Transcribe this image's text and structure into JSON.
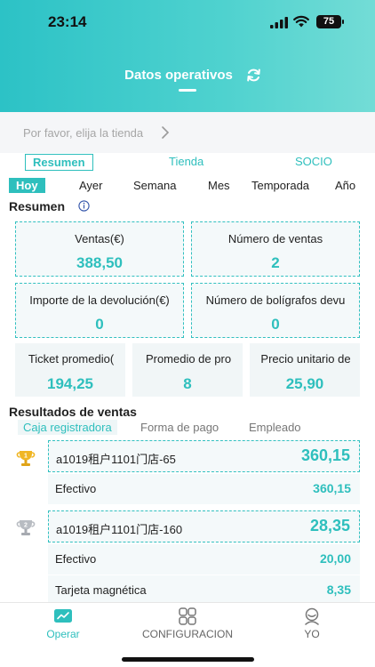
{
  "status_bar": {
    "time": "23:14",
    "battery": "75"
  },
  "header": {
    "title": "Datos operativos"
  },
  "store_selector": {
    "placeholder": "Por favor, elija la tienda"
  },
  "main_tabs": [
    {
      "label": "Resumen",
      "active": true
    },
    {
      "label": "Tienda",
      "active": false
    },
    {
      "label": "SOCIO",
      "active": false
    }
  ],
  "period_tabs": [
    {
      "label": "Hoy",
      "active": true
    },
    {
      "label": "Ayer",
      "active": false
    },
    {
      "label": "Semana",
      "active": false
    },
    {
      "label": "Mes",
      "active": false
    },
    {
      "label": "Temporada",
      "active": false
    },
    {
      "label": "Año",
      "active": false
    }
  ],
  "summary": {
    "title": "Resumen",
    "cards": [
      {
        "label": "Ventas(€)",
        "value": "388,50"
      },
      {
        "label": "Número de ventas",
        "value": "2"
      },
      {
        "label": "Importe de la devolución(€)",
        "value": "0"
      },
      {
        "label": "Número de bolígrafos devu",
        "value": "0"
      }
    ],
    "small_cards": [
      {
        "label": "Ticket promedio(",
        "value": "194,25"
      },
      {
        "label": "Promedio de pro",
        "value": "8"
      },
      {
        "label": "Precio unitario de",
        "value": "25,90"
      }
    ]
  },
  "sales_results": {
    "title": "Resultados de ventas",
    "tabs": [
      {
        "label": "Caja registradora",
        "active": true
      },
      {
        "label": "Forma de pago",
        "active": false
      },
      {
        "label": "Empleado",
        "active": false
      }
    ],
    "ranking": [
      {
        "rank_badge": "1",
        "name": "a1019租户1101门店-65",
        "amount": "360,15",
        "details": [
          {
            "label": "Efectivo",
            "amount": "360,15"
          }
        ]
      },
      {
        "rank_badge": "2",
        "name": "a1019租户1101门店-160",
        "amount": "28,35",
        "details": [
          {
            "label": "Efectivo",
            "amount": "20,00"
          },
          {
            "label": "Tarjeta magnética",
            "amount": "8,35"
          }
        ]
      }
    ]
  },
  "bottom_nav": [
    {
      "label": "Operar",
      "icon": "chart-icon",
      "active": true
    },
    {
      "label": "CONFIGURACION",
      "icon": "grid-icon",
      "active": false
    },
    {
      "label": "YO",
      "icon": "profile-icon",
      "active": false
    }
  ],
  "colors": {
    "accent": "#2ebfbd",
    "header_start": "#2cc2c6",
    "header_end": "#73dcd6"
  }
}
